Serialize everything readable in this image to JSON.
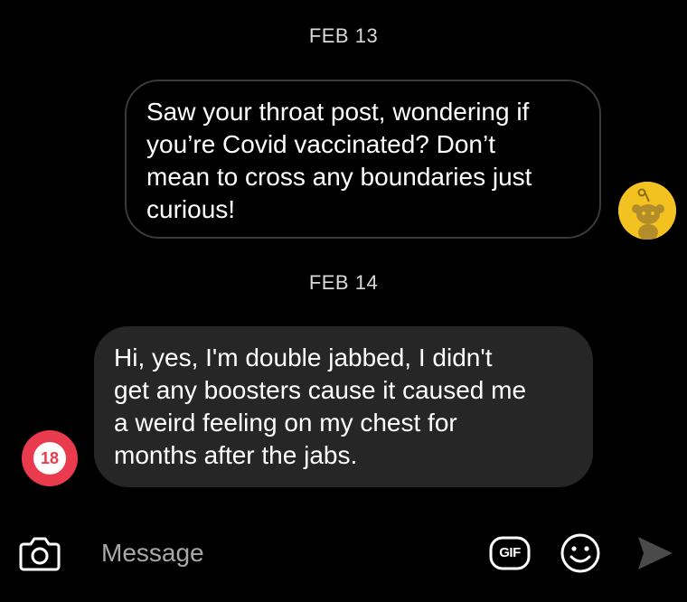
{
  "conversation": {
    "messages": [
      {
        "date": "FEB 13",
        "direction": "outgoing",
        "text": "Saw your throat post, wondering if you’re Covid vaccinated? Don’t mean to cross any boundaries just curious!",
        "lines": [
          "Saw your throat post, wondering if",
          "you’re Covid vaccinated? Don’t",
          "mean to cross any boundaries just",
          "curious!"
        ],
        "avatar_icon": "reddit-snoo-avatar",
        "avatar_color": "#f3c221"
      },
      {
        "date": "FEB 14",
        "direction": "incoming",
        "text": "Hi, yes, I'm double jabbed, I didn't get any boosters cause it caused me a weird feeling on my chest for months after the jabs.",
        "lines": [
          "Hi, yes, I'm double jabbed, I didn't",
          "get any boosters cause it caused me",
          "a weird feeling on my chest for",
          "months after the jabs."
        ],
        "avatar_icon": "age-18-badge-avatar",
        "avatar_label": "18",
        "avatar_color": "#ea3a4d"
      }
    ]
  },
  "composer": {
    "placeholder": "Message",
    "camera_icon": "camera-icon",
    "gif_label": "GIF",
    "emoji_icon": "smiley-icon",
    "send_icon": "send-arrow-icon"
  },
  "colors": {
    "background": "#000000",
    "incoming_bubble": "#262626",
    "outgoing_bubble_border": "#3a3a3a",
    "placeholder_text": "#a8a8a8"
  }
}
